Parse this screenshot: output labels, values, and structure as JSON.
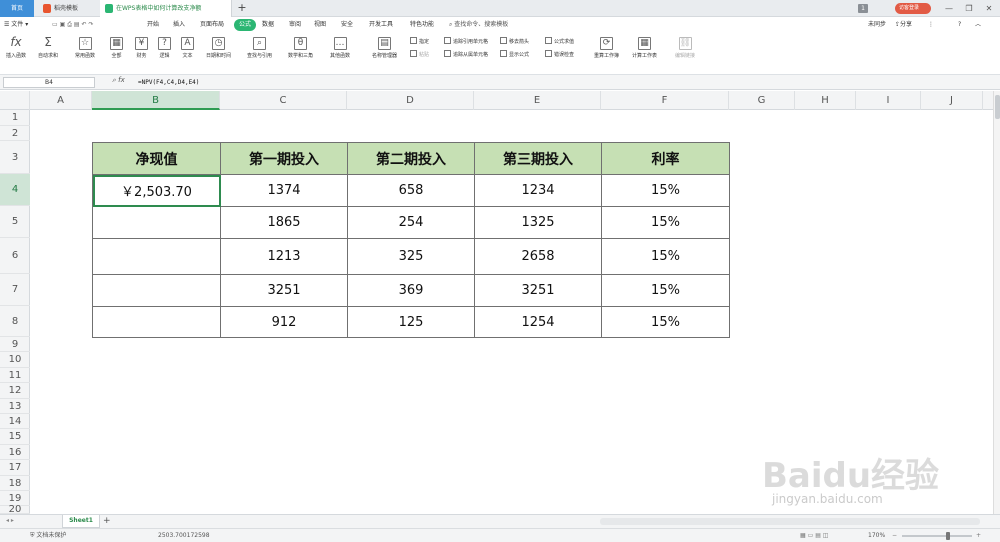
{
  "tabs": {
    "home": "首页",
    "doc": "稻壳模板",
    "active": "在WPS表格中如何计算改支净额",
    "add": "+"
  },
  "window": {
    "badge": "1",
    "login": "访客登录",
    "minimize": "—",
    "restore": "❐",
    "close": "✕"
  },
  "menu": {
    "file": "☰ 文件 ▾",
    "items": [
      "开始",
      "插入",
      "页面布局",
      "公式",
      "数据",
      "审阅",
      "视图",
      "安全",
      "开发工具",
      "特色功能"
    ],
    "active_index": 3,
    "search": "查找命令、搜索模板",
    "unsynced": "未同步",
    "share": "分享",
    "more": "⋮",
    "help": "?",
    "collapse": "︿"
  },
  "ribbon": {
    "insert_function": "插入函数",
    "autosum": "自动求和",
    "common": "常用函数",
    "all": "全部",
    "finance": "财务",
    "logic": "逻辑",
    "text": "文本",
    "datetime": "日期和时间",
    "lookup": "查找与引用",
    "math": "数学和三角",
    "other": "其他函数",
    "name_mgr": "名称管理器",
    "define": "指定",
    "paste": "粘贴",
    "trace_prec": "追踪引用单元格",
    "trace_dep": "追踪从属单元格",
    "remove_arrows": "移去箭头",
    "show_formula": "显示公式",
    "formula_eval": "公式求值",
    "error_check": "错误检查",
    "recalc_book": "重算工作簿",
    "calc_sheet": "计算工作表",
    "edit_links": "编辑链接"
  },
  "formula_bar": {
    "cell_ref": "B4",
    "formula": "=NPV(F4,C4,D4,E4)"
  },
  "columns": [
    "A",
    "B",
    "C",
    "D",
    "E",
    "F",
    "G",
    "H",
    "I",
    "J"
  ],
  "rows": [
    "1",
    "2",
    "3",
    "4",
    "5",
    "6",
    "7",
    "8",
    "9",
    "10",
    "11",
    "12",
    "13",
    "14",
    "15",
    "16",
    "17",
    "18",
    "19",
    "20"
  ],
  "table": {
    "headers": [
      "净现值",
      "第一期投入",
      "第二期投入",
      "第三期投入",
      "利率"
    ],
    "rows": [
      [
        "￥2,503.70",
        "1374",
        "658",
        "1234",
        "15%"
      ],
      [
        "",
        "1865",
        "254",
        "1325",
        "15%"
      ],
      [
        "",
        "1213",
        "325",
        "2658",
        "15%"
      ],
      [
        "",
        "3251",
        "369",
        "3251",
        "15%"
      ],
      [
        "",
        "912",
        "125",
        "1254",
        "15%"
      ]
    ]
  },
  "sheet": {
    "name": "Sheet1",
    "add": "+"
  },
  "status": {
    "protect": "文档未保护",
    "sum": "2503.700172598",
    "zoom": "170%"
  },
  "watermark": {
    "brand": "Baidu经验",
    "url": "jingyan.baidu.com"
  },
  "colors": {
    "header_fill": "#c6e0b4",
    "accent": "#2bb673",
    "selection": "#2e8b4f"
  }
}
